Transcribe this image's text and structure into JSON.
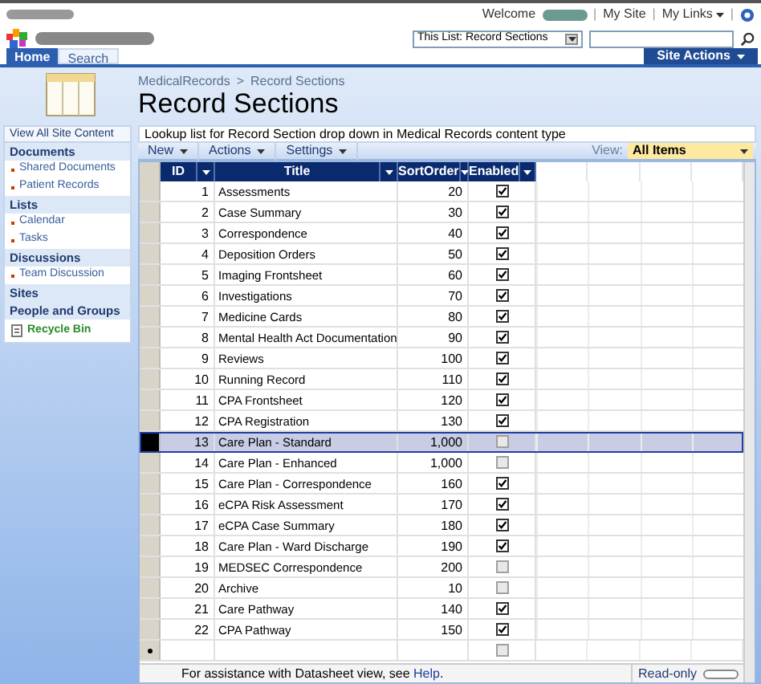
{
  "header": {
    "welcome": "Welcome",
    "separators": [
      "|",
      "|",
      "|"
    ],
    "links": [
      {
        "label": "My Site",
        "dropdown": false
      },
      {
        "label": "My Links",
        "dropdown": true
      }
    ]
  },
  "search": {
    "scope": "This List: Record Sections"
  },
  "tabs": [
    {
      "label": "Home",
      "selected": true
    },
    {
      "label": "Search",
      "selected": false
    }
  ],
  "site_actions": "Site Actions",
  "sidebar": {
    "view_all": "View All Site Content",
    "sections": [
      {
        "heading": "Documents",
        "items": [
          "Shared Documents",
          "Patient Records"
        ]
      },
      {
        "heading": "Lists",
        "items": [
          "Calendar",
          "Tasks"
        ]
      },
      {
        "heading": "Discussions",
        "items": [
          "Team Discussion"
        ]
      },
      {
        "heading": "Sites"
      },
      {
        "heading": "People and Groups"
      }
    ],
    "recycle_bin": "Recycle Bin"
  },
  "breadcrumb": {
    "parent": "MedicalRecords",
    "separator": ">",
    "current": "Record Sections"
  },
  "page_title": "Record Sections",
  "description": "Lookup list for Record Section drop down in Medical Records content type",
  "toolbar": [
    "New",
    "Actions",
    "Settings"
  ],
  "view": {
    "label": "View:",
    "value": "All Items"
  },
  "table": {
    "columns": [
      "ID",
      "Title",
      "SortOrder",
      "Enabled"
    ],
    "rows": [
      {
        "id": "1",
        "title": "Assessments",
        "sort_order": "20",
        "enabled": true,
        "selected": false
      },
      {
        "id": "2",
        "title": "Case Summary",
        "sort_order": "30",
        "enabled": true,
        "selected": false
      },
      {
        "id": "3",
        "title": "Correspondence",
        "sort_order": "40",
        "enabled": true,
        "selected": false
      },
      {
        "id": "4",
        "title": "Deposition Orders",
        "sort_order": "50",
        "enabled": true,
        "selected": false
      },
      {
        "id": "5",
        "title": "Imaging Frontsheet",
        "sort_order": "60",
        "enabled": true,
        "selected": false
      },
      {
        "id": "6",
        "title": "Investigations",
        "sort_order": "70",
        "enabled": true,
        "selected": false
      },
      {
        "id": "7",
        "title": "Medicine Cards",
        "sort_order": "80",
        "enabled": true,
        "selected": false
      },
      {
        "id": "8",
        "title": "Mental Health Act Documentation",
        "sort_order": "90",
        "enabled": true,
        "selected": false
      },
      {
        "id": "9",
        "title": "Reviews",
        "sort_order": "100",
        "enabled": true,
        "selected": false
      },
      {
        "id": "10",
        "title": "Running Record",
        "sort_order": "110",
        "enabled": true,
        "selected": false
      },
      {
        "id": "11",
        "title": "CPA Frontsheet",
        "sort_order": "120",
        "enabled": true,
        "selected": false
      },
      {
        "id": "12",
        "title": "CPA Registration",
        "sort_order": "130",
        "enabled": true,
        "selected": false
      },
      {
        "id": "13",
        "title": "Care Plan - Standard",
        "sort_order": "1,000",
        "enabled": false,
        "selected": true
      },
      {
        "id": "14",
        "title": "Care Plan - Enhanced",
        "sort_order": "1,000",
        "enabled": false,
        "selected": false
      },
      {
        "id": "15",
        "title": "Care Plan - Correspondence",
        "sort_order": "160",
        "enabled": true,
        "selected": false
      },
      {
        "id": "16",
        "title": "eCPA Risk Assessment",
        "sort_order": "170",
        "enabled": true,
        "selected": false
      },
      {
        "id": "17",
        "title": "eCPA Case Summary",
        "sort_order": "180",
        "enabled": true,
        "selected": false
      },
      {
        "id": "18",
        "title": "Care Plan - Ward Discharge",
        "sort_order": "190",
        "enabled": true,
        "selected": false
      },
      {
        "id": "19",
        "title": "MEDSEC Correspondence",
        "sort_order": "200",
        "enabled": false,
        "selected": false
      },
      {
        "id": "20",
        "title": "Archive",
        "sort_order": "10",
        "enabled": false,
        "selected": false
      },
      {
        "id": "21",
        "title": "Care Pathway",
        "sort_order": "140",
        "enabled": true,
        "selected": false
      },
      {
        "id": "22",
        "title": "CPA Pathway",
        "sort_order": "150",
        "enabled": true,
        "selected": false
      }
    ],
    "new_row": {
      "enabled": false
    }
  },
  "footer": {
    "text": "For assistance with Datasheet view, see",
    "link": "Help",
    "after": ".",
    "status": "Read-only"
  }
}
